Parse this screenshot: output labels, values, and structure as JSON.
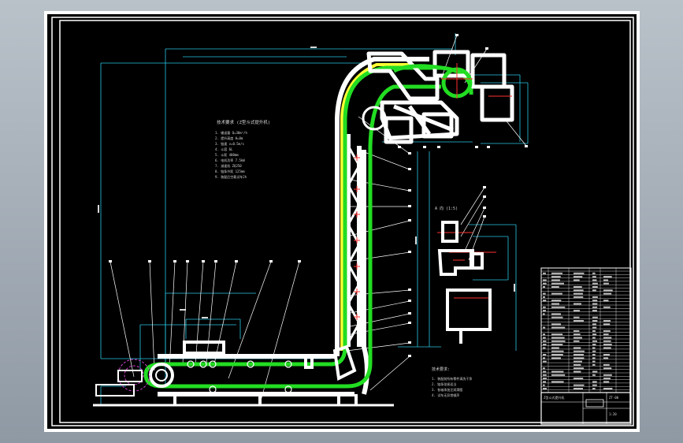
{
  "viewport": {
    "background": "#9aa3ad",
    "sheet_color": "#000000",
    "frame_color": "#ffffff",
    "chain_color": "#22dd22",
    "guide_color": "#ffff33",
    "dim_color": "#29c7e6",
    "marker_color": "#ff3030",
    "label_color": "#ffffff"
  },
  "drawing": {
    "tech_notes_title": "技术要求 (Z型斗式提升机)",
    "tech_notes": [
      "1. 输送量 Q=30m³/h",
      "2. 提升高度 H=8m",
      "3. 链速 v=0.5m/s",
      "4. 斗容 6L",
      "5. 斗距 400mm",
      "6. 电机功率 7.5kW",
      "7. 减速机 ZQ250",
      "8. 链条节距 125mm",
      "9. 装配后空载试车2h"
    ],
    "lower_notes_title": "技术要求:",
    "lower_notes": [
      "1. 装配前所有零件清洗干净",
      "2. 链条张紧适当",
      "3. 各轴承加注润滑脂",
      "4. 试车无异常噪声"
    ],
    "detail_label": "A 向 (1:5)",
    "title_block": {
      "drawing_title": "Z型斗式提升机",
      "drawing_no": "ZT-00",
      "scale": "1:20"
    }
  }
}
